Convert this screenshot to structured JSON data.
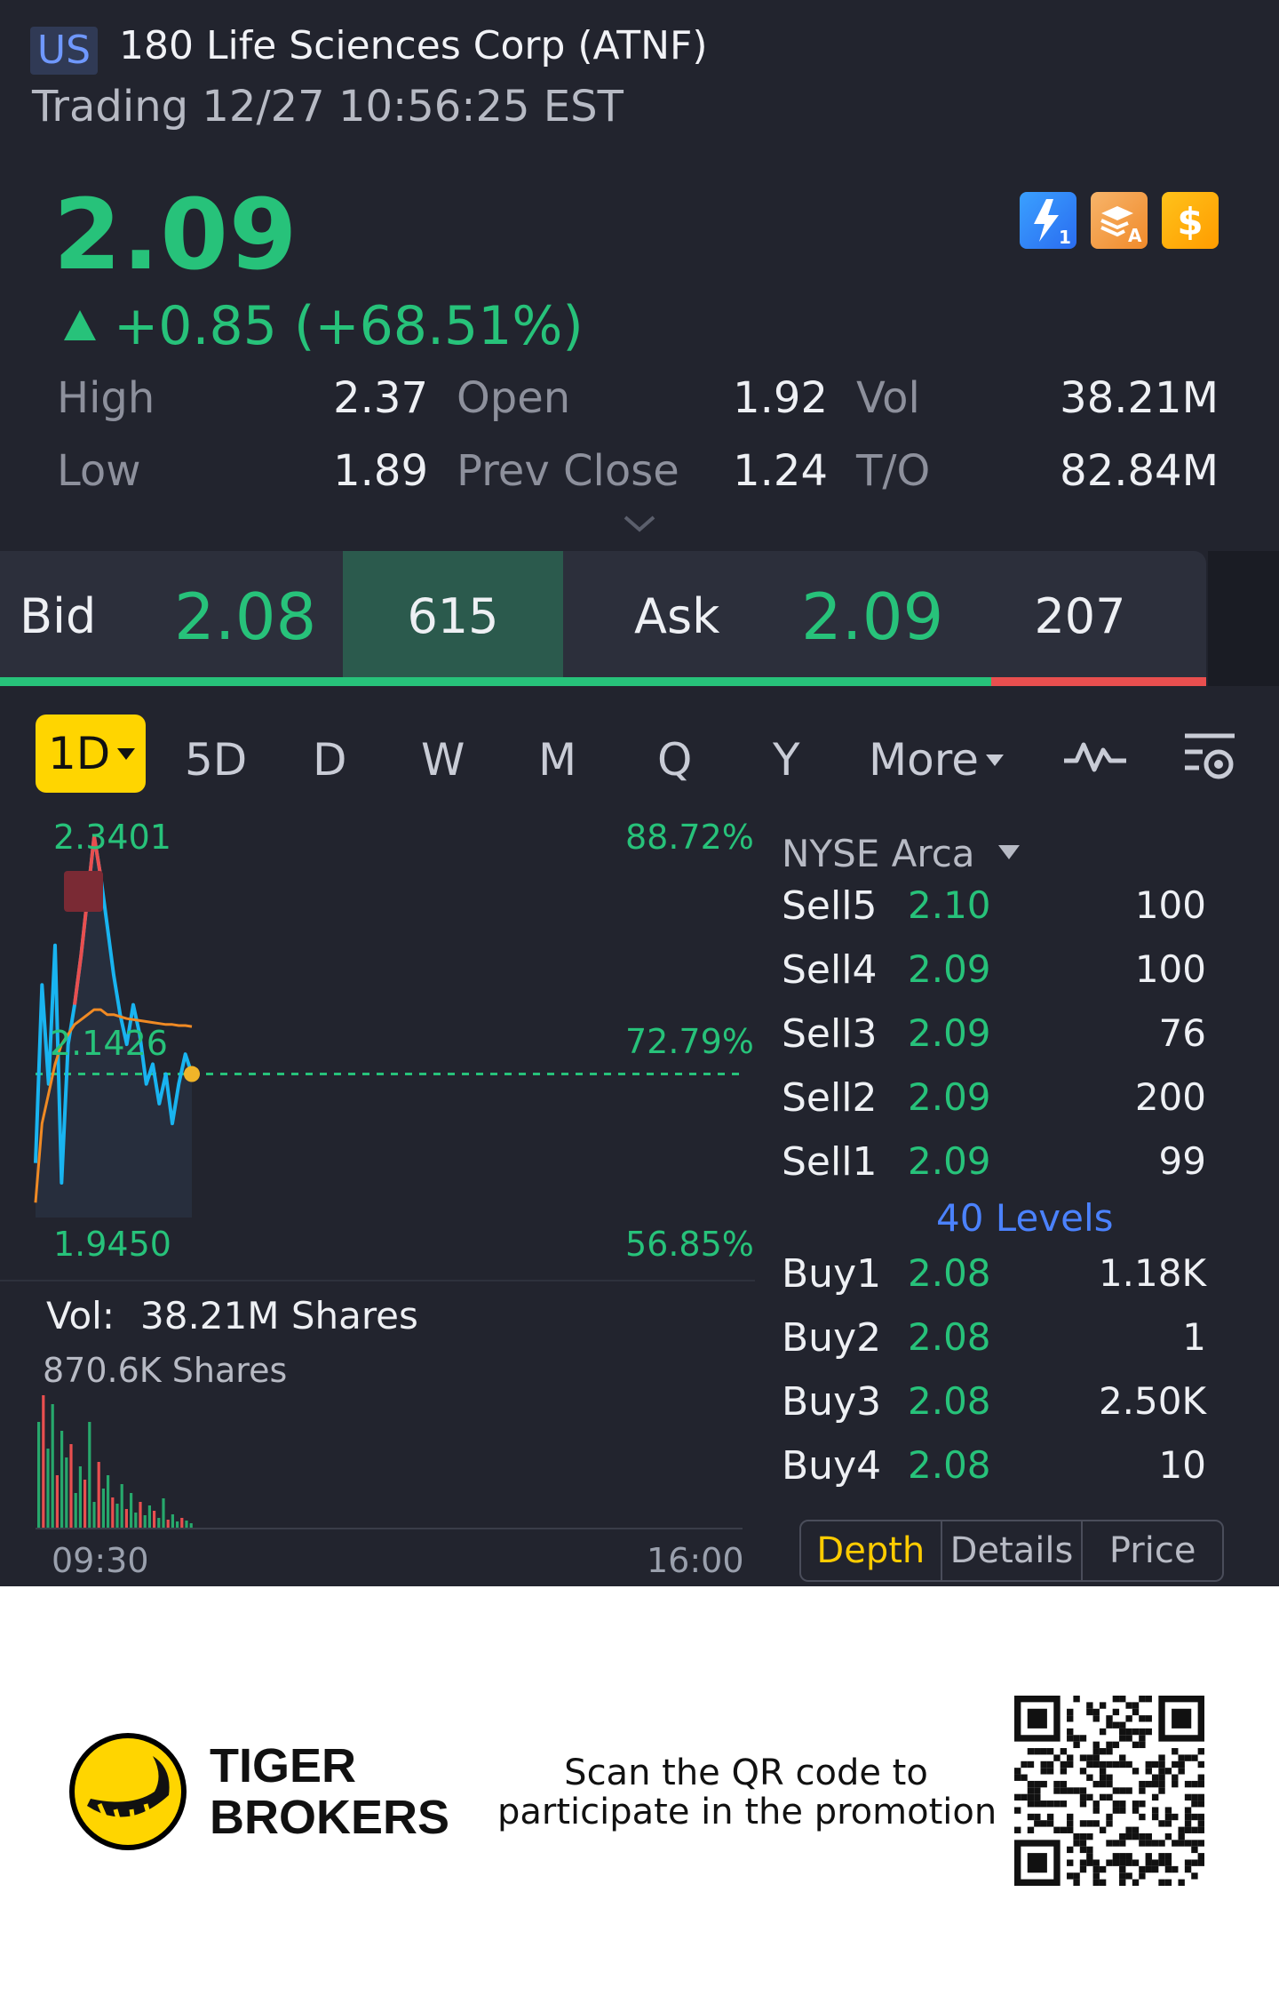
{
  "header": {
    "region": "US",
    "title": "180 Life Sciences Corp (ATNF)",
    "status": "Trading 12/27 10:56:25 EST"
  },
  "quote": {
    "price": "2.09",
    "change": "+0.85 (+68.51%)",
    "stats": {
      "high_label": "High",
      "high": "2.37",
      "low_label": "Low",
      "low": "1.89",
      "open_label": "Open",
      "open": "1.92",
      "prev_close_label": "Prev Close",
      "prev_close": "1.24",
      "vol_label": "Vol",
      "vol": "38.21M",
      "turnover_label": "T/O",
      "turnover": "82.84M"
    },
    "icons": [
      "lightning-level1-icon",
      "stack-a-icon",
      "dollar-icon"
    ]
  },
  "bidask": {
    "bid_label": "Bid",
    "bid_price": "2.08",
    "bid_size": "615",
    "ask_label": "Ask",
    "ask_price": "2.09",
    "ask_size": "207"
  },
  "periods": {
    "active": "1D",
    "tabs": [
      "5D",
      "D",
      "W",
      "M",
      "Q",
      "Y"
    ],
    "more": "More"
  },
  "chart": {
    "max_price": "2.3401",
    "mid_price": "2.1426",
    "min_price": "1.9450",
    "max_pct": "88.72%",
    "mid_pct": "72.79%",
    "min_pct": "56.85%",
    "vol_label": "Vol:",
    "vol_value": "38.21M Shares",
    "vol_max": "870.6K Shares",
    "time_start": "09:30",
    "time_end": "16:00"
  },
  "chart_data": {
    "type": "line",
    "series": [
      {
        "values": [
          2.0,
          2.18,
          2.08,
          2.22,
          1.98,
          2.12,
          2.16,
          2.21,
          2.27,
          2.33,
          2.29,
          2.24,
          2.19,
          2.15,
          2.12,
          2.16,
          2.13,
          2.08,
          2.1,
          2.06,
          2.09,
          2.04,
          2.08,
          2.11,
          2.09
        ]
      },
      {
        "values": [
          1.96,
          2.04,
          2.07,
          2.1,
          2.12,
          2.13,
          2.14,
          2.145,
          2.15,
          2.155,
          2.155,
          2.15,
          2.15,
          2.148,
          2.146,
          2.145,
          2.144,
          2.143,
          2.142,
          2.141,
          2.14,
          2.14,
          2.139,
          2.139,
          2.138
        ]
      }
    ],
    "ylim": [
      1.945,
      2.3401
    ],
    "reference": 2.09
  },
  "depth": {
    "exchange": "NYSE Arca",
    "sells": [
      {
        "label": "Sell5",
        "price": "2.10",
        "qty": "100"
      },
      {
        "label": "Sell4",
        "price": "2.09",
        "qty": "100"
      },
      {
        "label": "Sell3",
        "price": "2.09",
        "qty": "76"
      },
      {
        "label": "Sell2",
        "price": "2.09",
        "qty": "200"
      },
      {
        "label": "Sell1",
        "price": "2.09",
        "qty": "99"
      }
    ],
    "levels": "40 Levels",
    "buys": [
      {
        "label": "Buy1",
        "price": "2.08",
        "qty": "1.18K"
      },
      {
        "label": "Buy2",
        "price": "2.08",
        "qty": "1"
      },
      {
        "label": "Buy3",
        "price": "2.08",
        "qty": "2.50K"
      },
      {
        "label": "Buy4",
        "price": "2.08",
        "qty": "10"
      }
    ],
    "tabs": [
      "Depth",
      "Details",
      "Price"
    ]
  },
  "footer": {
    "brand_line1": "TIGER",
    "brand_line2": "BROKERS",
    "promo_line1": "Scan the QR code to",
    "promo_line2": "participate in the promotion"
  },
  "colors": {
    "up": "#27c27a",
    "down": "#e94f4f",
    "accent": "#ffd500",
    "background": "#22242e"
  }
}
